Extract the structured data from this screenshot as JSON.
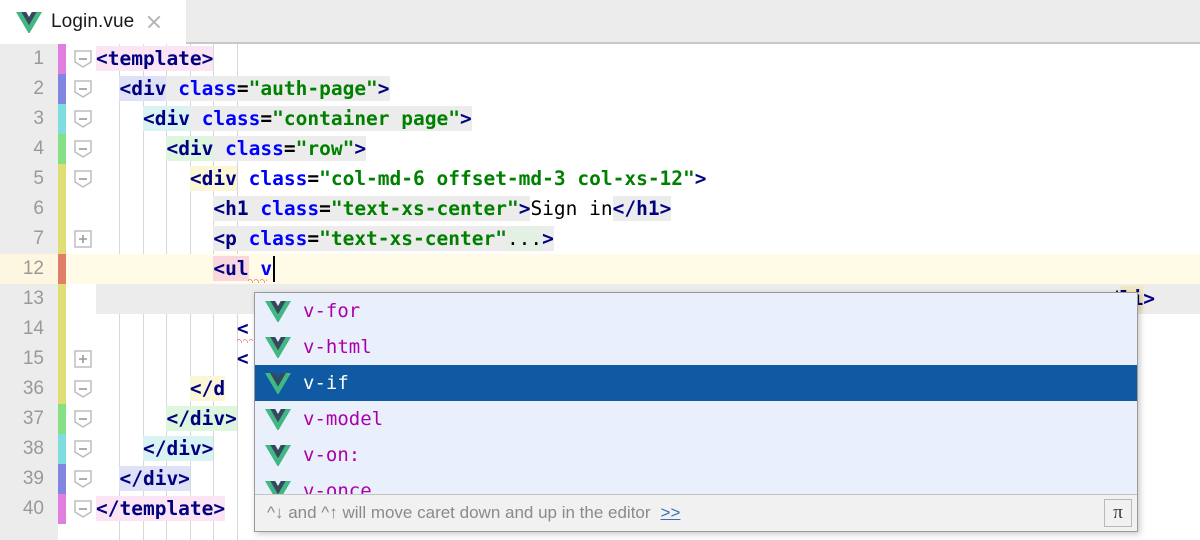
{
  "window": {
    "tab": {
      "icon": "vue-logo-icon",
      "label": "Login.vue",
      "close_icon": "close-icon"
    }
  },
  "editor": {
    "lines": [
      {
        "num": "1",
        "stripe": "#e07fe0",
        "fold": "minus",
        "indent": 0,
        "segments": [
          {
            "t": "<template>",
            "c": "tg",
            "hl": "h-pink"
          }
        ]
      },
      {
        "num": "2",
        "stripe": "#8186e0",
        "fold": "minus",
        "indent": 1,
        "segments": [
          {
            "t": "  ",
            "c": "tx",
            "hl": ""
          },
          {
            "t": "<div",
            "c": "tg",
            "hl": "h-blue"
          },
          {
            "t": " ",
            "c": "tx",
            "hl": "h-gray"
          },
          {
            "t": "class",
            "c": "at",
            "hl": "h-gray"
          },
          {
            "t": "=",
            "c": "eq",
            "hl": "h-gray"
          },
          {
            "t": "\"auth-page\"",
            "c": "vl",
            "hl": "h-gray"
          },
          {
            "t": ">",
            "c": "tg",
            "hl": "h-gray"
          }
        ]
      },
      {
        "num": "3",
        "stripe": "#7fdde0",
        "fold": "minus",
        "indent": 2,
        "segments": [
          {
            "t": "    ",
            "c": "tx",
            "hl": ""
          },
          {
            "t": "<div",
            "c": "tg",
            "hl": "h-cyan"
          },
          {
            "t": " ",
            "c": "tx",
            "hl": "h-gray"
          },
          {
            "t": "class",
            "c": "at",
            "hl": "h-gray"
          },
          {
            "t": "=",
            "c": "eq",
            "hl": "h-gray"
          },
          {
            "t": "\"container page\"",
            "c": "vl",
            "hl": "h-gray"
          },
          {
            "t": ">",
            "c": "tg",
            "hl": "h-gray"
          }
        ]
      },
      {
        "num": "4",
        "stripe": "#86de86",
        "fold": "minus",
        "indent": 3,
        "segments": [
          {
            "t": "      ",
            "c": "tx",
            "hl": ""
          },
          {
            "t": "<div",
            "c": "tg",
            "hl": "h-green"
          },
          {
            "t": " ",
            "c": "tx",
            "hl": "h-gray"
          },
          {
            "t": "class",
            "c": "at",
            "hl": "h-gray"
          },
          {
            "t": "=",
            "c": "eq",
            "hl": "h-gray"
          },
          {
            "t": "\"row\"",
            "c": "vl",
            "hl": "h-gray"
          },
          {
            "t": ">",
            "c": "tg",
            "hl": "h-gray"
          }
        ]
      },
      {
        "num": "5",
        "stripe": "#e0de72",
        "fold": "minus",
        "indent": 4,
        "segments": [
          {
            "t": "        ",
            "c": "tx",
            "hl": ""
          },
          {
            "t": "<div",
            "c": "tg",
            "hl": "h-yellow"
          },
          {
            "t": " ",
            "c": "tx",
            "hl": ""
          },
          {
            "t": "class",
            "c": "at",
            "hl": ""
          },
          {
            "t": "=",
            "c": "eq",
            "hl": ""
          },
          {
            "t": "\"col-md-6 offset-md-3 col-xs-12\"",
            "c": "vl",
            "hl": ""
          },
          {
            "t": ">",
            "c": "tg",
            "hl": ""
          }
        ]
      },
      {
        "num": "6",
        "stripe": "#e0de72",
        "fold": "none",
        "indent": 5,
        "segments": [
          {
            "t": "          ",
            "c": "tx",
            "hl": ""
          },
          {
            "t": "<h1",
            "c": "tg",
            "hl": "h-gray"
          },
          {
            "t": " ",
            "c": "tx",
            "hl": "h-gray"
          },
          {
            "t": "class",
            "c": "at",
            "hl": "h-gray"
          },
          {
            "t": "=",
            "c": "eq",
            "hl": "h-gray"
          },
          {
            "t": "\"text-xs-center\"",
            "c": "vl",
            "hl": "h-gray"
          },
          {
            "t": ">",
            "c": "tg",
            "hl": "h-gray"
          },
          {
            "t": "Sign in",
            "c": "tx",
            "hl": ""
          },
          {
            "t": "</h1>",
            "c": "tg",
            "hl": "h-gray"
          }
        ]
      },
      {
        "num": "7",
        "stripe": "#e0de72",
        "fold": "plus",
        "indent": 5,
        "segments": [
          {
            "t": "          ",
            "c": "tx",
            "hl": ""
          },
          {
            "t": "<p",
            "c": "tg",
            "hl": "h-gray"
          },
          {
            "t": " ",
            "c": "tx",
            "hl": "h-gray"
          },
          {
            "t": "class",
            "c": "at",
            "hl": "h-gray"
          },
          {
            "t": "=",
            "c": "eq",
            "hl": "h-gray"
          },
          {
            "t": "\"text-xs-center\"",
            "c": "vl",
            "hl": "h-gray"
          },
          {
            "t": "...",
            "c": "tx",
            "hl": "h-fold"
          },
          {
            "t": ">",
            "c": "tg",
            "hl": "h-gray"
          }
        ]
      },
      {
        "num": "12",
        "stripe": "#df7f6a",
        "fold": "none",
        "indent": 5,
        "current": true,
        "segments": [
          {
            "t": "          ",
            "c": "tx",
            "hl": ""
          },
          {
            "t": "<ul",
            "c": "tg",
            "hl": "h-err"
          },
          {
            "t": " ",
            "c": "tx",
            "hl": ""
          },
          {
            "t": "v",
            "c": "at",
            "hl": ""
          }
        ],
        "caret": true,
        "squiggle": true
      },
      {
        "num": "13",
        "stripe": "#e0de72",
        "fold": "none",
        "indent": 6,
        "selected": true,
        "segments": [],
        "tail": [
          {
            "t": "/",
            "c": "tx",
            "hl": "h-gray"
          },
          {
            "t": "li",
            "c": "tg",
            "hl": "h-tan"
          },
          {
            "t": ">",
            "c": "tg",
            "hl": "h-gray"
          }
        ]
      },
      {
        "num": "14",
        "stripe": "#e0de72",
        "fold": "none",
        "indent": 6,
        "segments": [
          {
            "t": "            ",
            "c": "tx",
            "hl": ""
          },
          {
            "t": "<",
            "c": "tg",
            "hl": ""
          }
        ],
        "squiggle14": true
      },
      {
        "num": "15",
        "stripe": "#e0de72",
        "fold": "plus",
        "indent": 6,
        "segments": [
          {
            "t": "            ",
            "c": "tx",
            "hl": ""
          },
          {
            "t": "<",
            "c": "tg",
            "hl": ""
          }
        ]
      },
      {
        "num": "36",
        "stripe": "#e0de72",
        "fold": "minus",
        "indent": 4,
        "segments": [
          {
            "t": "        ",
            "c": "tx",
            "hl": ""
          },
          {
            "t": "</d",
            "c": "tg",
            "hl": "h-yellow"
          }
        ]
      },
      {
        "num": "37",
        "stripe": "#86de86",
        "fold": "minus",
        "indent": 3,
        "segments": [
          {
            "t": "      ",
            "c": "tx",
            "hl": ""
          },
          {
            "t": "</div>",
            "c": "tg",
            "hl": "h-green"
          }
        ]
      },
      {
        "num": "38",
        "stripe": "#7fdde0",
        "fold": "minus",
        "indent": 2,
        "segments": [
          {
            "t": "    ",
            "c": "tx",
            "hl": ""
          },
          {
            "t": "</div>",
            "c": "tg",
            "hl": "h-cyan"
          }
        ]
      },
      {
        "num": "39",
        "stripe": "#8186e0",
        "fold": "minus",
        "indent": 1,
        "segments": [
          {
            "t": "  ",
            "c": "tx",
            "hl": ""
          },
          {
            "t": "</div>",
            "c": "tg",
            "hl": "h-blue"
          }
        ]
      },
      {
        "num": "40",
        "stripe": "#e07fe0",
        "fold": "minus",
        "indent": 0,
        "segments": [
          {
            "t": "</template>",
            "c": "tg",
            "hl": "h-pink"
          }
        ]
      }
    ]
  },
  "autocomplete": {
    "items": [
      {
        "icon": "vue-logo-icon",
        "label": "v-for",
        "selected": false
      },
      {
        "icon": "vue-logo-icon",
        "label": "v-html",
        "selected": false
      },
      {
        "icon": "vue-logo-icon",
        "label": "v-if",
        "selected": true
      },
      {
        "icon": "vue-logo-icon",
        "label": "v-model",
        "selected": false
      },
      {
        "icon": "vue-logo-icon",
        "label": "v-on:",
        "selected": false
      },
      {
        "icon": "vue-logo-icon",
        "label": "v-once",
        "selected": false
      }
    ],
    "footer": {
      "hint": "^↓ and ^↑ will move caret down and up in the editor",
      "more_link": ">>",
      "button_label": "π",
      "button_icon": "pi-settings-icon"
    }
  },
  "colors": {
    "selection_blue": "#0f5aa3",
    "popup_bg": "#eaf0fb",
    "current_line": "#fffbe6",
    "error_red": "#e8453c",
    "vue_green": "#41b883",
    "vue_navy": "#35495e"
  }
}
